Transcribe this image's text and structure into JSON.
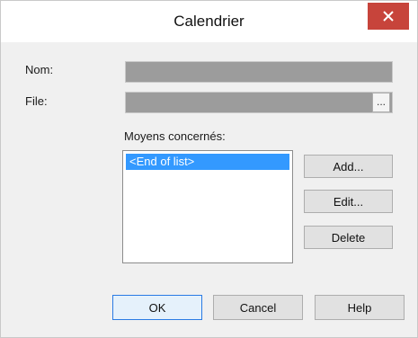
{
  "window": {
    "title": "Calendrier",
    "close_icon": "close-icon"
  },
  "form": {
    "nom_label": "Nom:",
    "nom_value": "",
    "file_label": "File:",
    "file_value": "",
    "browse_label": "...",
    "list_label": "Moyens concernés:",
    "list_items": [
      "<End of list>"
    ]
  },
  "actions": {
    "add_label": "Add...",
    "edit_label": "Edit...",
    "delete_label": "Delete"
  },
  "footer": {
    "ok_label": "OK",
    "cancel_label": "Cancel",
    "help_label": "Help"
  },
  "colors": {
    "close_button": "#c7443b",
    "selection": "#3399ff",
    "disabled_field": "#9c9c9c"
  }
}
